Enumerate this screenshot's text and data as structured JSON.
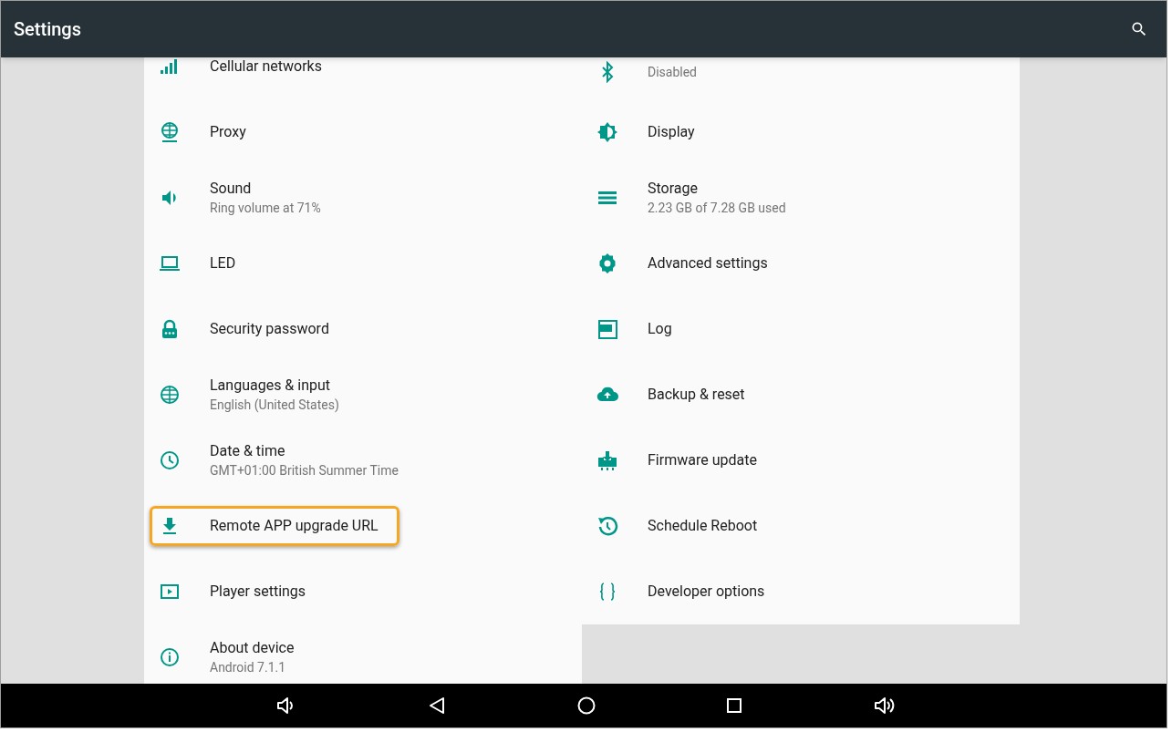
{
  "app_bar": {
    "title": "Settings"
  },
  "columns": [
    [
      {
        "title": "Cellular networks",
        "highlighted": false
      },
      {
        "title": "Proxy",
        "highlighted": false
      },
      {
        "title": "Sound",
        "summary": "Ring volume at 71%",
        "highlighted": false
      },
      {
        "title": "LED",
        "highlighted": false
      },
      {
        "title": "Security password",
        "highlighted": false
      },
      {
        "title": "Languages & input",
        "summary": "English (United States)",
        "highlighted": false
      },
      {
        "title": "Date & time",
        "summary": "GMT+01:00 British Summer Time",
        "highlighted": false
      },
      {
        "title": "Remote APP upgrade URL",
        "highlighted": true
      },
      {
        "title": "Player settings",
        "highlighted": false
      },
      {
        "title": "About device",
        "summary": "Android 7.1.1",
        "highlighted": false
      }
    ],
    [
      {
        "summary": "Disabled",
        "highlighted": false
      },
      {
        "title": "Display",
        "highlighted": false
      },
      {
        "title": "Storage",
        "summary": "2.23 GB of 7.28 GB used",
        "highlighted": false
      },
      {
        "title": "Advanced settings",
        "highlighted": false
      },
      {
        "title": "Log",
        "highlighted": false
      },
      {
        "title": "Backup & reset",
        "highlighted": false
      },
      {
        "title": "Firmware update",
        "highlighted": false
      },
      {
        "title": "Schedule Reboot",
        "highlighted": false
      },
      {
        "title": "Developer options",
        "highlighted": false
      }
    ]
  ]
}
